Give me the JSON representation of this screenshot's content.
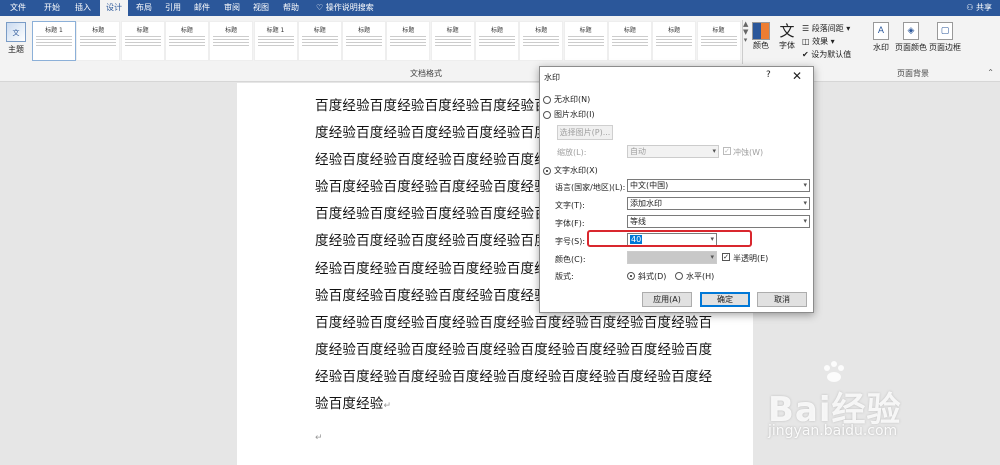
{
  "ribbon_tabs": [
    "文件",
    "开始",
    "插入",
    "设计",
    "布局",
    "引用",
    "邮件",
    "审阅",
    "视图",
    "帮助"
  ],
  "active_tab": "设计",
  "help_search": "操作说明搜索",
  "share_label": "共享",
  "theme_label": "主题",
  "style_gallery": {
    "tiles": [
      "标题 1",
      "标题",
      "标题",
      "标题",
      "标题",
      "标题 1",
      "标题",
      "标题",
      "标题",
      "标题",
      "标题",
      "标题",
      "标题",
      "标题",
      "标题",
      "标题"
    ],
    "group_label": "文档格式"
  },
  "colors_label": "颜色",
  "fonts_label": "字体",
  "fonts_glyph": "文",
  "paragraph_spacing": "段落间距",
  "effects": "效果",
  "set_default": "设为默认值",
  "watermark_label": "水印",
  "page_color_label": "页面颜色",
  "page_border_label": "页面边框",
  "page_background_group": "页面背景",
  "document": {
    "lines": [
      "百度经验百度经验百度经验百度经验百度经",
      "度经验百度经验百度经验百度经验百度经验",
      "经验百度经验百度经验百度经验百度经验百",
      "验百度经验百度经验百度经验百度经验百度",
      "百度经验百度经验百度经验百度经验百度经",
      "度经验百度经验百度经验百度经验百度经验",
      "经验百度经验百度经验百度经验百度经验百",
      "验百度经验百度经验百度经验百度经验百度",
      "百度经验百度经验百度经验百度经验百度经验百度经验百度经验百",
      "度经验百度经验百度经验百度经验百度经验百度经验百度经验百度",
      "经验百度经验百度经验百度经验百度经验百度经验百度经验百度经",
      "验百度经验"
    ]
  },
  "dialog": {
    "title": "水印",
    "help": "?",
    "no_watermark": "无水印(N)",
    "picture_watermark": "图片水印(I)",
    "select_picture": "选择图片(P)...",
    "scale_label": "缩放(L):",
    "scale_value": "自动",
    "washout": "冲蚀(W)",
    "text_watermark": "文字水印(X)",
    "language_label": "语言(国家/地区)(L):",
    "language_value": "中文(中国)",
    "text_label": "文字(T):",
    "text_value": "添加水印",
    "font_label": "字体(F):",
    "font_value": "等线",
    "size_label": "字号(S):",
    "size_value": "40",
    "color_label": "颜色(C):",
    "semitransparent": "半透明(E)",
    "layout_label": "版式:",
    "diagonal": "斜式(D)",
    "horizontal": "水平(H)",
    "apply": "应用(A)",
    "ok": "确定",
    "cancel": "取消"
  },
  "watermark_brand": {
    "logo": "Bai经验",
    "url": "jingyan.baidu.com"
  }
}
